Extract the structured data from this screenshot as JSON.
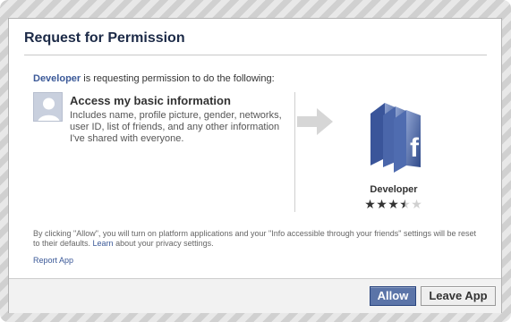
{
  "dialog": {
    "title": "Request for Permission",
    "intro": {
      "app_link": "Developer",
      "text": " is requesting permission to do the following:"
    },
    "permission": {
      "title": "Access my basic information",
      "description": "Includes name, profile picture, gender, networks, user ID, list of friends, and any other information I've shared with everyone."
    },
    "app": {
      "name": "Developer",
      "rating": 3.5,
      "rating_max": 5,
      "icon": "facebook-developer-icon"
    },
    "disclaimer": {
      "before": "By clicking \"Allow\", you will turn on platform applications and your \"Info accessible through your friends\" settings will be reset to their defaults. ",
      "learn_link": "Learn",
      "after": " about your privacy settings."
    },
    "report_link": "Report App",
    "buttons": {
      "allow": "Allow",
      "leave": "Leave App"
    }
  },
  "colors": {
    "brand": "#3b5998",
    "title": "#1c2a47",
    "allow_button": "#5b74a8"
  }
}
